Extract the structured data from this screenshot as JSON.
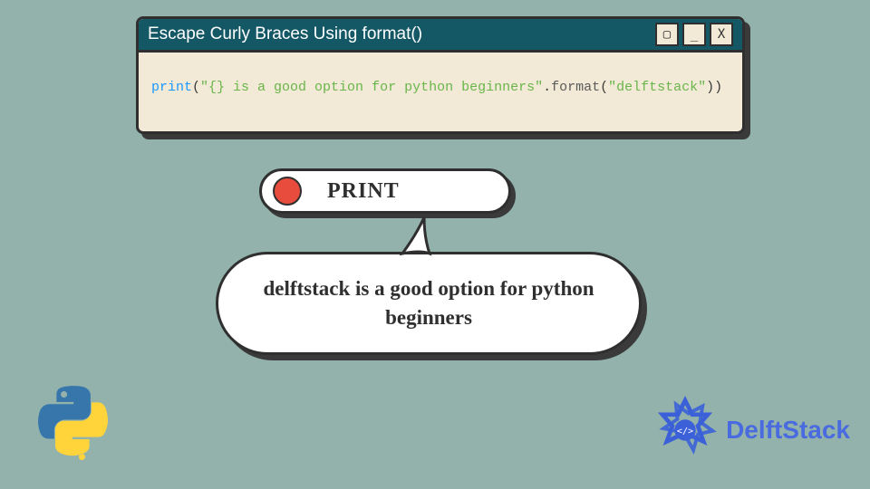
{
  "window": {
    "title": "Escape Curly Braces Using format()",
    "buttons": {
      "minimize": "▢",
      "maximize": "_",
      "close": "X"
    }
  },
  "code": {
    "fn": "print",
    "open": "(",
    "str1": "\"{} is a good option for python beginners\"",
    "dot": ".",
    "method": "format",
    "open2": "(",
    "str2": "\"delftstack\"",
    "close": "))"
  },
  "print_label": "PRINT",
  "output": "delftstack is a good option for python beginners",
  "brand": "DelftStack"
}
